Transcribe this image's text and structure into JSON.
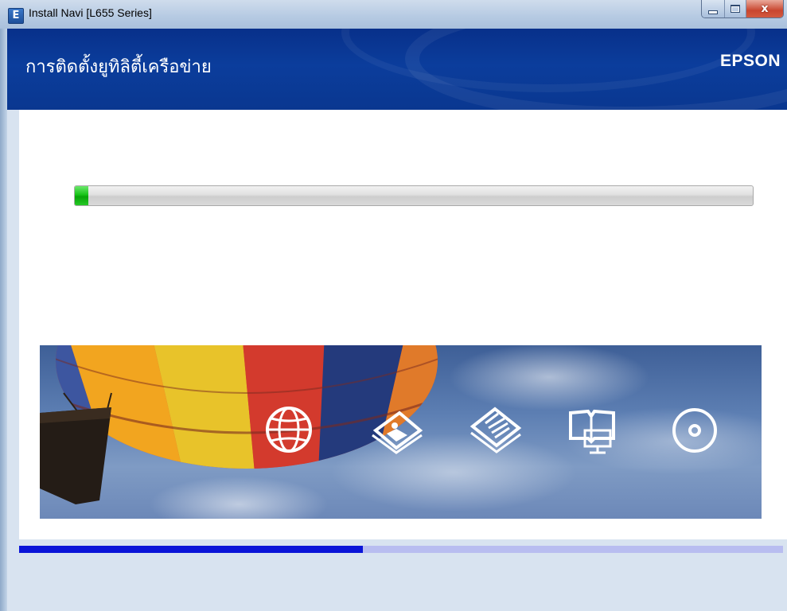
{
  "window": {
    "title": "Install Navi [L655 Series]",
    "app_icon_glyph": "E",
    "close_glyph": "x"
  },
  "header": {
    "title": "การติดตั้งยูทิลิตี้เครือข่าย",
    "brand": "EPSON"
  },
  "install_progress": {
    "fraction": 0.02
  },
  "feature_icons": [
    {
      "name": "globe-icon"
    },
    {
      "name": "photo-print-icon"
    },
    {
      "name": "documents-icon"
    },
    {
      "name": "manual-book-icon"
    },
    {
      "name": "disc-icon"
    }
  ],
  "step_progress": {
    "fraction": 0.45
  },
  "colors": {
    "header_blue": "#0b3d9c",
    "progress_green": "#18c418",
    "step_blue": "#0a14d8",
    "step_track": "#b8bdf0"
  }
}
